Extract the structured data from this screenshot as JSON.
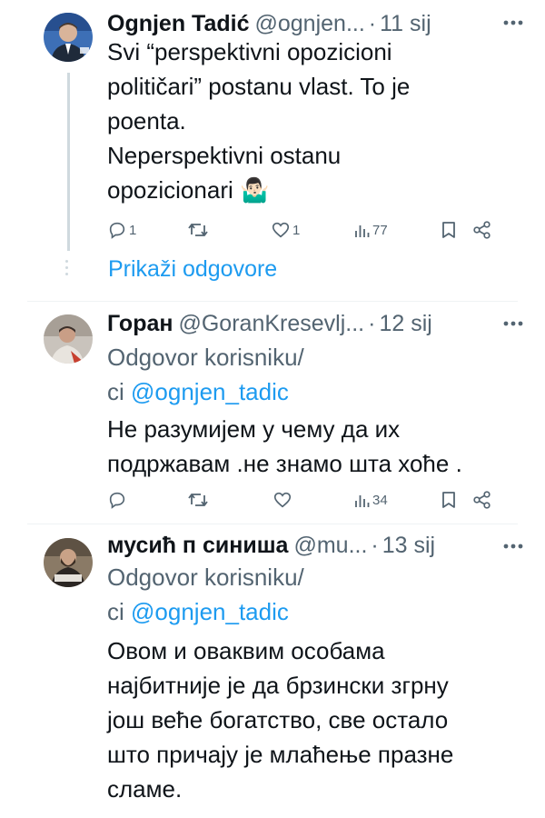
{
  "tweets": [
    {
      "name": "Ognjen Tadić",
      "handle": "@ognjen...",
      "sep": "·",
      "time": "11 sij",
      "text_lines": [
        "Svi “perspektivni opozicioni",
        "političari” postanu vlast. To je",
        "poenta.",
        "Neperspektivni ostanu",
        "opozicionari 🤷🏻‍♂️"
      ],
      "replies": "1",
      "retweets": "",
      "likes": "1",
      "views": "77",
      "avatar_icon": "man-suit-avatar"
    },
    {
      "name": "Горан",
      "handle": "@GoranKresevlj...",
      "sep": "·",
      "time": "12 sij",
      "reply_prefix": "Odgovor korisniku/",
      "reply_ci": "ci",
      "reply_mention": "@ognjen_tadic",
      "text_lines": [
        "Не разумијем у чему да их",
        "подржавам .не знамо шта хоће ."
      ],
      "replies": "",
      "retweets": "",
      "likes": "",
      "views": "34",
      "avatar_icon": "man-portrait-avatar"
    },
    {
      "name": "мусић п синиша",
      "handle": "@mu...",
      "sep": "·",
      "time": "13 sij",
      "reply_prefix": "Odgovor korisniku/",
      "reply_ci": "ci",
      "reply_mention": "@ognjen_tadic",
      "text_lines": [
        "Овом и оваквим особама",
        "најбитније је да брзински згрну",
        "још веће богатство, све остало",
        "што причају је млаћење празне",
        "сламе."
      ],
      "avatar_icon": "bearded-man-avatar"
    }
  ],
  "show_replies_label": "Prikaži odgovore",
  "colors": {
    "accent": "#1d9bf0",
    "secondary": "#536471",
    "text": "#0f1419",
    "line": "#cfd9de"
  }
}
